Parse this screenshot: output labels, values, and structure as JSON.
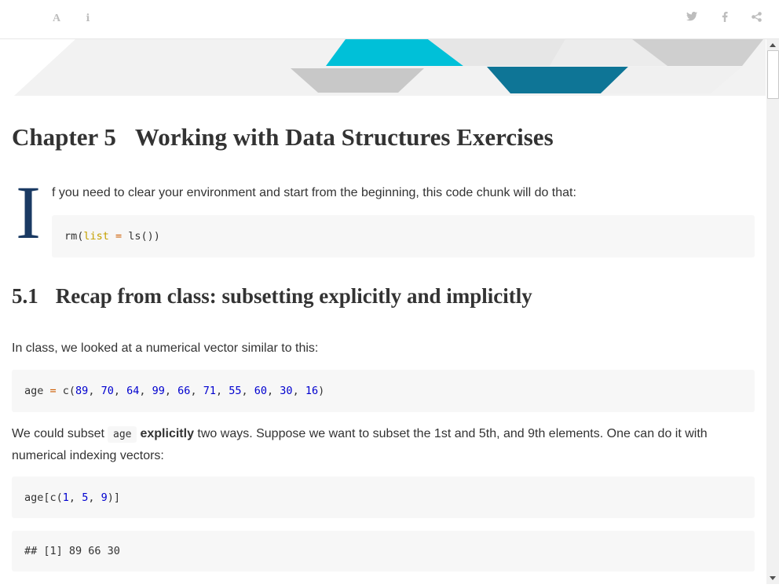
{
  "toolbar": {
    "left_icons": [
      "font-icon",
      "info-icon"
    ],
    "right_icons": [
      "twitter-icon",
      "facebook-icon",
      "share-icon"
    ],
    "info_glyph": "ℹ"
  },
  "chapter": {
    "number": "Chapter 5",
    "title": "Working with Data Structures Exercises"
  },
  "intro": {
    "dropcap": "I",
    "text": "f you need to clear your environment and start from the beginning, this code chunk will do that:",
    "code": {
      "fn": "rm(",
      "arg": "list",
      "eq": " = ",
      "rest": "ls())"
    }
  },
  "section": {
    "number": "5.1",
    "title": "Recap from class: subsetting explicitly and implicitly",
    "para1": "In class, we looked at a numerical vector similar to this:",
    "code1": {
      "var": "age",
      "assign": " = ",
      "fn": "c(",
      "values": [
        "89",
        "70",
        "64",
        "99",
        "66",
        "71",
        "55",
        "60",
        "30",
        "16"
      ],
      "close": ")"
    },
    "para2_before": "We could subset",
    "para2_code": "age",
    "para2_bold": "explicitly",
    "para2_after": " two ways. Suppose we want to subset the 1st and 5th, and 9th elements. One can do it with numerical indexing vectors:",
    "code2": {
      "prefix": "age[c(",
      "values": [
        "1",
        "5",
        "9"
      ],
      "suffix": ")]"
    },
    "output": "## [1] 89 66 30"
  },
  "colors": {
    "accent_dark": "#1a3a63",
    "teal": "#00c0d8",
    "dark_teal": "#0e7596",
    "grey": "#c8c8c8"
  }
}
